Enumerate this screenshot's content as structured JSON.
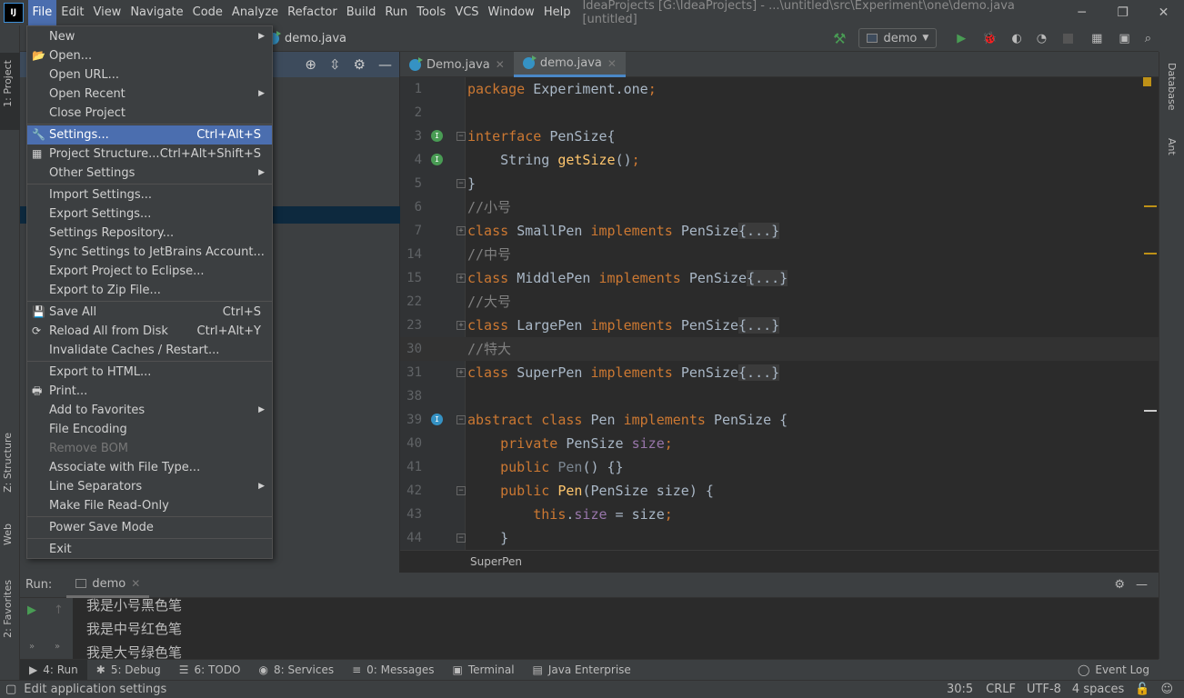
{
  "app": {
    "title": "IdeaProjects [G:\\IdeaProjects] - ...\\untitled\\src\\Experiment\\one\\demo.java [untitled]",
    "logo": "IJ"
  },
  "menubar": [
    "File",
    "Edit",
    "View",
    "Navigate",
    "Code",
    "Analyze",
    "Refactor",
    "Build",
    "Run",
    "Tools",
    "VCS",
    "Window",
    "Help"
  ],
  "navbar": {
    "file": "demo.java",
    "run_config": "demo"
  },
  "left_stripe": {
    "project": "1: Project",
    "structure": "Z: Structure",
    "web": "Web",
    "favorites": "2: Favorites"
  },
  "right_stripe": {
    "database": "Database",
    "ant": "Ant"
  },
  "tabs": [
    {
      "label": "Demo.java",
      "active": false
    },
    {
      "label": "demo.java",
      "active": true
    }
  ],
  "file_menu": [
    {
      "label": "New",
      "submenu": true
    },
    {
      "label": "Open...",
      "icon": "folder-icon"
    },
    {
      "label": "Open URL..."
    },
    {
      "label": "Open Recent",
      "submenu": true
    },
    {
      "label": "Close Project"
    },
    {
      "sep": true
    },
    {
      "label": "Settings...",
      "shortcut": "Ctrl+Alt+S",
      "icon": "wrench-icon",
      "selected": true
    },
    {
      "label": "Project Structure...",
      "shortcut": "Ctrl+Alt+Shift+S",
      "icon": "structure-icon"
    },
    {
      "label": "Other Settings",
      "submenu": true
    },
    {
      "sep": true
    },
    {
      "label": "Import Settings..."
    },
    {
      "label": "Export Settings..."
    },
    {
      "label": "Settings Repository..."
    },
    {
      "label": "Sync Settings to JetBrains Account..."
    },
    {
      "label": "Export Project to Eclipse..."
    },
    {
      "label": "Export to Zip File..."
    },
    {
      "sep": true
    },
    {
      "label": "Save All",
      "shortcut": "Ctrl+S",
      "icon": "save-icon"
    },
    {
      "label": "Reload All from Disk",
      "shortcut": "Ctrl+Alt+Y",
      "icon": "reload-icon"
    },
    {
      "label": "Invalidate Caches / Restart..."
    },
    {
      "sep": true
    },
    {
      "label": "Export to HTML..."
    },
    {
      "label": "Print...",
      "icon": "print-icon"
    },
    {
      "label": "Add to Favorites",
      "submenu": true
    },
    {
      "label": "File Encoding"
    },
    {
      "label": "Remove BOM",
      "disabled": true
    },
    {
      "label": "Associate with File Type..."
    },
    {
      "label": "Line Separators",
      "submenu": true
    },
    {
      "label": "Make File Read-Only"
    },
    {
      "sep": true
    },
    {
      "label": "Power Save Mode"
    },
    {
      "sep": true
    },
    {
      "label": "Exit"
    }
  ],
  "editor": {
    "current_line": "30",
    "lines": [
      {
        "n": "1",
        "t": [
          [
            "package ",
            "kw"
          ],
          [
            "Experiment.one",
            ""
          ],
          [
            ";",
            "kw"
          ]
        ]
      },
      {
        "n": "2",
        "t": []
      },
      {
        "n": "3",
        "mark": "I",
        "fold": "-",
        "t": [
          [
            "interface ",
            "kw"
          ],
          [
            "PenSize{",
            ""
          ]
        ]
      },
      {
        "n": "4",
        "mark": "I",
        "t": [
          [
            "    String ",
            ""
          ],
          [
            "getSize",
            "fn"
          ],
          [
            "()",
            ""
          ],
          [
            ";",
            "kw"
          ]
        ]
      },
      {
        "n": "5",
        "fold": "-",
        "t": [
          [
            "}",
            ""
          ]
        ]
      },
      {
        "n": "6",
        "t": [
          [
            "//小号",
            "cm"
          ]
        ]
      },
      {
        "n": "7",
        "fold": "+",
        "t": [
          [
            "class ",
            "kw"
          ],
          [
            "SmallPen ",
            ""
          ],
          [
            "implements ",
            "kw"
          ],
          [
            "PenSize",
            ""
          ],
          [
            "{...}",
            "fold"
          ]
        ]
      },
      {
        "n": "14",
        "t": [
          [
            "//中号",
            "cm"
          ]
        ]
      },
      {
        "n": "15",
        "fold": "+",
        "t": [
          [
            "class ",
            "kw"
          ],
          [
            "MiddlePen ",
            ""
          ],
          [
            "implements ",
            "kw"
          ],
          [
            "PenSize",
            ""
          ],
          [
            "{...}",
            "fold"
          ]
        ]
      },
      {
        "n": "22",
        "t": [
          [
            "//大号",
            "cm"
          ]
        ]
      },
      {
        "n": "23",
        "fold": "+",
        "t": [
          [
            "class ",
            "kw"
          ],
          [
            "LargePen ",
            ""
          ],
          [
            "implements ",
            "kw"
          ],
          [
            "PenSize",
            ""
          ],
          [
            "{...}",
            "fold"
          ]
        ]
      },
      {
        "n": "30",
        "t": [
          [
            "//特大",
            "cm"
          ]
        ]
      },
      {
        "n": "31",
        "fold": "+",
        "t": [
          [
            "class ",
            "kw"
          ],
          [
            "SuperPen ",
            ""
          ],
          [
            "implements ",
            "kw"
          ],
          [
            "PenSize",
            ""
          ],
          [
            "{...}",
            "fold"
          ]
        ]
      },
      {
        "n": "38",
        "t": []
      },
      {
        "n": "39",
        "mark": "O",
        "fold": "-",
        "t": [
          [
            "abstract class ",
            "kw"
          ],
          [
            "Pen ",
            ""
          ],
          [
            "implements ",
            "kw"
          ],
          [
            "PenSize {",
            ""
          ]
        ]
      },
      {
        "n": "40",
        "t": [
          [
            "    private ",
            "kw"
          ],
          [
            "PenSize ",
            ""
          ],
          [
            "size",
            "fd"
          ],
          [
            ";",
            "kw"
          ]
        ]
      },
      {
        "n": "41",
        "t": [
          [
            "    public ",
            "kw"
          ],
          [
            "Pen",
            "un"
          ],
          [
            "() {}",
            ""
          ]
        ]
      },
      {
        "n": "42",
        "fold": "-",
        "t": [
          [
            "    public ",
            "kw"
          ],
          [
            "Pen",
            "fn"
          ],
          [
            "(PenSize size) {",
            ""
          ]
        ]
      },
      {
        "n": "43",
        "t": [
          [
            "        this",
            "kw"
          ],
          [
            ".",
            ""
          ],
          [
            "size",
            "fd"
          ],
          [
            " = size",
            ""
          ],
          [
            ";",
            "kw"
          ]
        ]
      },
      {
        "n": "44",
        "fold": "-",
        "t": [
          [
            "    }",
            ""
          ]
        ]
      }
    ]
  },
  "breadcrumb": "SuperPen",
  "run": {
    "label": "Run:",
    "tab": "demo",
    "output": [
      "我是小号黑色笔",
      "我是中号红色笔",
      "我是大号绿色笔"
    ]
  },
  "tool_tabs": [
    {
      "label": "4: Run",
      "active": true
    },
    {
      "label": "5: Debug"
    },
    {
      "label": "6: TODO"
    },
    {
      "label": "8: Services"
    },
    {
      "label": "0: Messages"
    },
    {
      "label": "Terminal"
    },
    {
      "label": "Java Enterprise"
    }
  ],
  "event_log": "Event Log",
  "status": {
    "message": "Edit application settings",
    "position": "30:5",
    "line_sep": "CRLF",
    "encoding": "UTF-8",
    "indent": "4 spaces"
  },
  "colors": {
    "accent": "#4b6eaf",
    "keyword": "#cc7832",
    "run_green": "#499c54"
  }
}
